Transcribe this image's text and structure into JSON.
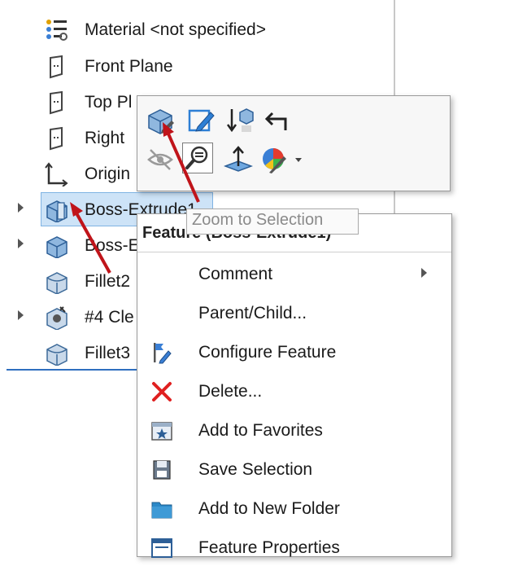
{
  "tree": {
    "items": [
      {
        "label": "Material <not specified>",
        "icon": "material-icon",
        "has_arrow": false
      },
      {
        "label": "Front Plane",
        "icon": "plane-icon",
        "has_arrow": false
      },
      {
        "label": "Top Pl",
        "icon": "plane-icon",
        "has_arrow": false
      },
      {
        "label": "Right",
        "icon": "plane-icon",
        "has_arrow": false
      },
      {
        "label": "Origin",
        "icon": "origin-icon",
        "has_arrow": false
      },
      {
        "label": "Boss-Extrude1",
        "icon": "extrude-icon",
        "has_arrow": true,
        "selected": true
      },
      {
        "label": "Boss-E",
        "icon": "extrude-icon",
        "has_arrow": true
      },
      {
        "label": "Fillet2",
        "icon": "fillet-icon",
        "has_arrow": false
      },
      {
        "label": "#4 Cle",
        "icon": "hole-wizard-icon",
        "has_arrow": true
      },
      {
        "label": "Fillet3",
        "icon": "fillet-icon",
        "has_arrow": false
      }
    ]
  },
  "toolbar": {
    "buttons": [
      {
        "name": "edit-feature-button",
        "icon": "edit-feature-icon"
      },
      {
        "name": "edit-sketch-button",
        "icon": "edit-sketch-icon"
      },
      {
        "name": "rollback-button",
        "icon": "rollback-icon"
      },
      {
        "name": "parent-child-button",
        "icon": "return-arrow-icon"
      },
      {
        "name": "hide-button",
        "icon": "hide-eye-icon"
      },
      {
        "name": "zoom-to-selection-button",
        "icon": "zoom-icon"
      },
      {
        "name": "normal-to-button",
        "icon": "normal-to-icon"
      },
      {
        "name": "appearance-button",
        "icon": "appearance-icon"
      }
    ],
    "tooltip": "Zoom to Selection"
  },
  "context_menu": {
    "header": "Feature (Boss-Extrude1)",
    "items": [
      {
        "label": "Comment",
        "icon": "",
        "submenu": true
      },
      {
        "label": "Parent/Child...",
        "icon": ""
      },
      {
        "label": "Configure Feature",
        "icon": "configure-feature-icon"
      },
      {
        "label": "Delete...",
        "icon": "delete-icon"
      },
      {
        "label": "Add to Favorites",
        "icon": "favorites-icon"
      },
      {
        "label": "Save Selection",
        "icon": "save-selection-icon"
      },
      {
        "label": "Add to New Folder",
        "icon": "folder-icon"
      },
      {
        "label": "Feature Properties",
        "icon": "feature-properties-icon"
      }
    ]
  },
  "colors": {
    "selection": "#cde3f7",
    "annotation_arrow": "#c0141a",
    "delete": "#e02020"
  }
}
